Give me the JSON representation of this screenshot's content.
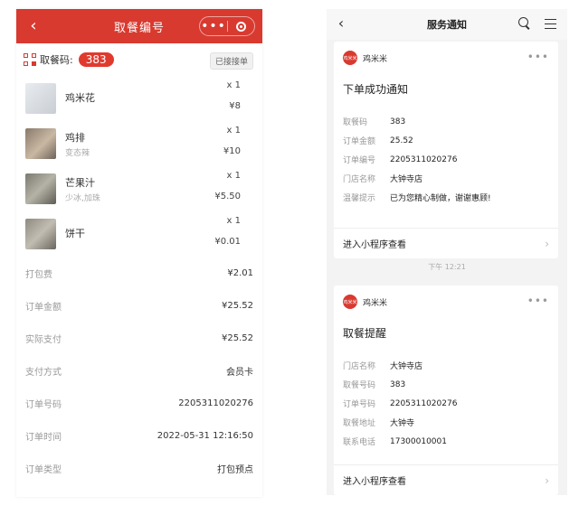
{
  "left": {
    "header": {
      "title": "取餐编号"
    },
    "pickup": {
      "label": "取餐码:",
      "number": "383",
      "status": "已接接单"
    },
    "items": [
      {
        "name": "鸡米花",
        "sub": "",
        "qty": "x 1",
        "price": "¥8"
      },
      {
        "name": "鸡排",
        "sub": "变态辣",
        "qty": "x 1",
        "price": "¥10"
      },
      {
        "name": "芒果汁",
        "sub": "少冰,加珠",
        "qty": "x 1",
        "price": "¥5.50"
      },
      {
        "name": "饼干",
        "sub": "",
        "qty": "x 1",
        "price": "¥0.01"
      }
    ],
    "info": [
      {
        "k": "打包费",
        "v": "¥2.01"
      },
      {
        "k": "订单金额",
        "v": "¥25.52"
      },
      {
        "k": "实际支付",
        "v": "¥25.52"
      },
      {
        "k": "支付方式",
        "v": "会员卡"
      },
      {
        "k": "订单号码",
        "v": "2205311020276"
      },
      {
        "k": "订单时间",
        "v": "2022-05-31 12:16:50"
      },
      {
        "k": "订单类型",
        "v": "打包预点"
      }
    ]
  },
  "right": {
    "header": {
      "title": "服务通知"
    },
    "card1": {
      "logo": "鸡米米",
      "brand": "鸡米米",
      "title": "下单成功通知",
      "fields": [
        {
          "k": "取餐码",
          "v": "383"
        },
        {
          "k": "订单金额",
          "v": "25.52"
        },
        {
          "k": "订单编号",
          "v": "2205311020276"
        },
        {
          "k": "门店名称",
          "v": "大钟寺店"
        },
        {
          "k": "温馨提示",
          "v": "已为您精心制做，谢谢惠顾!"
        }
      ],
      "footer": "进入小程序查看"
    },
    "timestamp": "下午 12:21",
    "card2": {
      "logo": "鸡米米",
      "brand": "鸡米米",
      "title": "取餐提醒",
      "fields": [
        {
          "k": "门店名称",
          "v": "大钟寺店"
        },
        {
          "k": "取餐号码",
          "v": "383"
        },
        {
          "k": "订单号码",
          "v": "2205311020276"
        },
        {
          "k": "取餐地址",
          "v": "大钟寺"
        },
        {
          "k": "联系电话",
          "v": "17300010001"
        }
      ],
      "footer": "进入小程序查看"
    }
  }
}
